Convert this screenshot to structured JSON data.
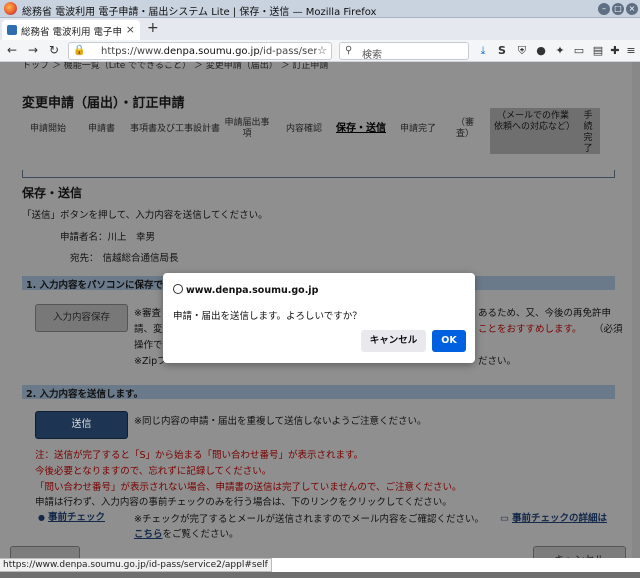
{
  "window": {
    "title": "総務省 電波利用 電子申請・届出システム Lite | 保存・送信 — Mozilla Firefox",
    "tab_label": "総務省 電波利用 電子申請・届",
    "new_tab": "+"
  },
  "navbar": {
    "url_prefix": "https://www.",
    "url_domain": "denpa.soumu.go.jp",
    "url_suffix": "/id-pass/servic",
    "search_placeholder": "検索"
  },
  "page": {
    "breadcrumb": "トップ ＞ 機能一覧（Lite でできること） ＞ 変更申請（届出） ＞ 訂正申請",
    "heading": "変更申請（届出）・訂正申請",
    "steps": [
      "申請開始",
      "申請書",
      "事項書及び工事設計書",
      "申請届出事項",
      "内容確認",
      "保存・送信",
      "申請完了",
      "（審査）",
      "（メールでの作業依頼への対応など）",
      "手続完了"
    ],
    "section_title": "保存・送信",
    "instruction": "「送信」ボタンを押して、入力内容を送信してください。",
    "applicant_label": "申請者名：",
    "applicant_value": "川上　幸男",
    "recipient_label": "宛先：",
    "recipient_value": "信越総合通信局長",
    "section1": "1. 入力内容をパソコンに保存で",
    "save_button": "入力内容保存",
    "note1_a": "※審査",
    "note1_a_right": "あるため、又、今後の再免許申",
    "note1_b": "請、変",
    "note1_b_right": "ことをおすすめします。",
    "note1_b_tail": "（必須",
    "note1_c": "操作で",
    "note1_d": "※Zipフ",
    "note1_d_right": "ださい。",
    "section2": "2. 入力内容を送信します。",
    "send_button": "送信",
    "note2": "※同じ内容の申請・届出を重複して送信しないようご注意ください。",
    "warn1": "注：送信が完了すると「S」から始まる「問い合わせ番号」が表示されます。",
    "warn2": "今後必要となりますので、忘れずに記録してください。",
    "warn3": "「問い合わせ番号」が表示されない場合、申請書の送信は完了していませんので、ご注意ください。",
    "info1": "申請は行わず、入力内容の事前チェックのみを行う場合は、下のリンクをクリックしてください。",
    "precheck_link": "事前チェック",
    "precheck_note": "※チェックが完了するとメールが送信されますのでメール内容をご確認ください。",
    "precheck_detail_link": "事前チェックの詳細は",
    "precheck_detail_link2": "こちら",
    "precheck_detail_tail": "をご覧ください。",
    "bottom_cancel": "キャンセル"
  },
  "dialog": {
    "origin": "www.denpa.soumu.go.jp",
    "message": "申請・届出を送信します。よろしいですか？",
    "cancel": "キャンセル",
    "ok": "OK"
  },
  "status_url": "https://www.denpa.soumu.go.jp/id-pass/service2/appl#self"
}
